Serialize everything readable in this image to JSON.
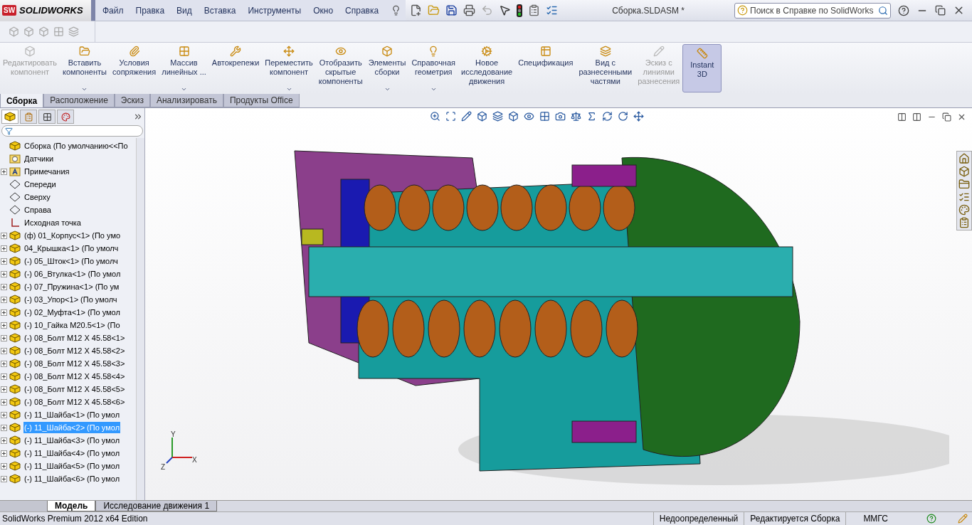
{
  "app_logo": {
    "badge": "SW",
    "text": "SOLIDWORKS"
  },
  "menu": [
    "Файл",
    "Правка",
    "Вид",
    "Вставка",
    "Инструменты",
    "Окно",
    "Справка"
  ],
  "window": {
    "title": "Сборка.SLDASM *"
  },
  "help_search": {
    "placeholder": "Поиск в Справке по SolidWorks"
  },
  "command_manager": [
    {
      "lines": [
        "Редактировать",
        "компонент"
      ],
      "disabled": true,
      "dropdown": false,
      "pressed": false
    },
    {
      "lines": [
        "Вставить",
        "компоненты"
      ],
      "disabled": false,
      "dropdown": true,
      "pressed": false
    },
    {
      "lines": [
        "Условия",
        "сопряжения"
      ],
      "disabled": false,
      "dropdown": false,
      "pressed": false
    },
    {
      "lines": [
        "Массив",
        "линейных ..."
      ],
      "disabled": false,
      "dropdown": true,
      "pressed": false
    },
    {
      "lines": [
        "Автокрепежи"
      ],
      "disabled": false,
      "dropdown": false,
      "pressed": false
    },
    {
      "lines": [
        "Переместить",
        "компонент"
      ],
      "disabled": false,
      "dropdown": true,
      "pressed": false
    },
    {
      "lines": [
        "Отобразить",
        "скрытые",
        "компоненты"
      ],
      "disabled": false,
      "dropdown": false,
      "pressed": false
    },
    {
      "lines": [
        "Элементы",
        "сборки"
      ],
      "disabled": false,
      "dropdown": true,
      "pressed": false
    },
    {
      "lines": [
        "Справочная",
        "геометрия"
      ],
      "disabled": false,
      "dropdown": true,
      "pressed": false
    },
    {
      "lines": [
        "Новое",
        "исследование",
        "движения"
      ],
      "disabled": false,
      "dropdown": false,
      "pressed": false
    },
    {
      "lines": [
        "Спецификация"
      ],
      "disabled": false,
      "dropdown": false,
      "pressed": false
    },
    {
      "lines": [
        "Вид с",
        "разнесенными",
        "частями"
      ],
      "disabled": false,
      "dropdown": false,
      "pressed": false
    },
    {
      "lines": [
        "Эскиз с",
        "линиями",
        "разнесения"
      ],
      "disabled": true,
      "dropdown": false,
      "pressed": false
    },
    {
      "lines": [
        "Instant",
        "3D"
      ],
      "disabled": false,
      "dropdown": false,
      "pressed": true
    }
  ],
  "command_tabs": [
    {
      "label": "Сборка",
      "selected": true
    },
    {
      "label": "Расположение",
      "selected": false
    },
    {
      "label": "Эскиз",
      "selected": false
    },
    {
      "label": "Анализировать",
      "selected": false
    },
    {
      "label": "Продукты Office",
      "selected": false
    }
  ],
  "feature_tree": {
    "root": {
      "label": "Сборка  (По умолчанию<<По",
      "kind": "assembly",
      "expandable": false,
      "selected": false,
      "children": [
        {
          "label": "Датчики",
          "kind": "sensors",
          "expandable": false,
          "selected": false
        },
        {
          "label": "Примечания",
          "kind": "annotations",
          "expandable": true,
          "selected": false
        },
        {
          "label": "Спереди",
          "kind": "plane",
          "expandable": false,
          "selected": false
        },
        {
          "label": "Сверху",
          "kind": "plane",
          "expandable": false,
          "selected": false
        },
        {
          "label": "Справа",
          "kind": "plane",
          "expandable": false,
          "selected": false
        },
        {
          "label": "Исходная точка",
          "kind": "origin",
          "expandable": false,
          "selected": false
        },
        {
          "label": "(ф) 01_Корпус<1> (По умо",
          "kind": "part",
          "expandable": true,
          "selected": false
        },
        {
          "label": "04_Крышка<1> (По умолч",
          "kind": "part",
          "expandable": true,
          "selected": false
        },
        {
          "label": "(-) 05_Шток<1> (По умолч",
          "kind": "part",
          "expandable": true,
          "selected": false
        },
        {
          "label": "(-) 06_Втулка<1> (По умол",
          "kind": "part",
          "expandable": true,
          "selected": false
        },
        {
          "label": "(-) 07_Пружина<1> (По ум",
          "kind": "part",
          "expandable": true,
          "selected": false
        },
        {
          "label": "(-) 03_Упор<1> (По умолч",
          "kind": "part",
          "expandable": true,
          "selected": false
        },
        {
          "label": "(-) 02_Муфта<1> (По умол",
          "kind": "part",
          "expandable": true,
          "selected": false
        },
        {
          "label": "(-) 10_Гайка M20.5<1> (По",
          "kind": "part",
          "expandable": true,
          "selected": false
        },
        {
          "label": "(-) 08_Болт M12 X 45.58<1>",
          "kind": "part",
          "expandable": true,
          "selected": false
        },
        {
          "label": "(-) 08_Болт M12 X 45.58<2>",
          "kind": "part",
          "expandable": true,
          "selected": false
        },
        {
          "label": "(-) 08_Болт M12 X 45.58<3>",
          "kind": "part",
          "expandable": true,
          "selected": false
        },
        {
          "label": "(-) 08_Болт M12 X 45.58<4>",
          "kind": "part",
          "expandable": true,
          "selected": false
        },
        {
          "label": "(-) 08_Болт M12 X 45.58<5>",
          "kind": "part",
          "expandable": true,
          "selected": false
        },
        {
          "label": "(-) 08_Болт M12 X 45.58<6>",
          "kind": "part",
          "expandable": true,
          "selected": false
        },
        {
          "label": "(-) 11_Шайба<1> (По умол",
          "kind": "part",
          "expandable": true,
          "selected": false
        },
        {
          "label": "(-) 11_Шайба<2> (По умол",
          "kind": "part",
          "expandable": true,
          "selected": true
        },
        {
          "label": "(-) 11_Шайба<3> (По умол",
          "kind": "part",
          "expandable": true,
          "selected": false
        },
        {
          "label": "(-) 11_Шайба<4> (По умол",
          "kind": "part",
          "expandable": true,
          "selected": false
        },
        {
          "label": "(-) 11_Шайба<5> (По умол",
          "kind": "part",
          "expandable": true,
          "selected": false
        },
        {
          "label": "(-) 11_Шайба<6> (По умол",
          "kind": "part",
          "expandable": true,
          "selected": false
        }
      ]
    }
  },
  "triad": {
    "x": "X",
    "y": "Y",
    "z": "Z"
  },
  "bottom_tabs": [
    {
      "label": "Модель",
      "selected": true
    },
    {
      "label": "Исследование движения 1",
      "selected": false
    }
  ],
  "status_bar": {
    "product": "SolidWorks Premium 2012 x64 Edition",
    "state": "Недоопределенный",
    "mode": "Редактируется Сборка",
    "units": "ММГС"
  }
}
